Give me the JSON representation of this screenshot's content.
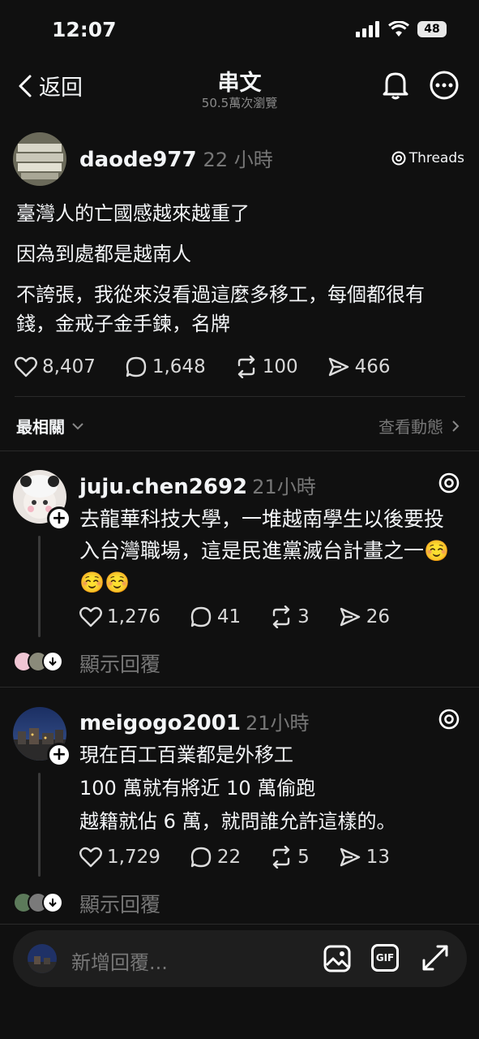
{
  "status": {
    "time": "12:07",
    "battery": "48"
  },
  "nav": {
    "back_label": "返回",
    "title": "串文",
    "views": "50.5萬次瀏覽"
  },
  "post": {
    "username": "daode977",
    "time": "22 小時",
    "source": "Threads",
    "paragraphs": [
      "臺灣人的亡國感越來越重了",
      "因為到處都是越南人",
      "不誇張，我從來沒看過這麼多移工，每個都很有錢，金戒子金手鍊，名牌"
    ],
    "likes": "8,407",
    "comments": "1,648",
    "reposts": "100",
    "shares": "466"
  },
  "sort": {
    "label": "最相關",
    "activity": "查看動態"
  },
  "replies": [
    {
      "username": "juju.chen2692",
      "time": "21小時",
      "lines": [
        "去龍華科技大學，一堆越南學生以後要投入台灣職場，這是民進黨滅台計畫之一☺️☺️☺️"
      ],
      "likes": "1,276",
      "comments": "41",
      "reposts": "3",
      "shares": "26",
      "show_replies": "顯示回覆"
    },
    {
      "username": "meigogo2001",
      "time": "21小時",
      "lines": [
        "現在百工百業都是外移工",
        "100 萬就有將近 10 萬偷跑",
        "越籍就佔 6 萬，就問誰允許這樣的。"
      ],
      "likes": "1,729",
      "comments": "22",
      "reposts": "5",
      "shares": "13",
      "show_replies": "顯示回覆"
    }
  ],
  "composer": {
    "placeholder": "新增回覆...",
    "gif_label": "GIF"
  }
}
